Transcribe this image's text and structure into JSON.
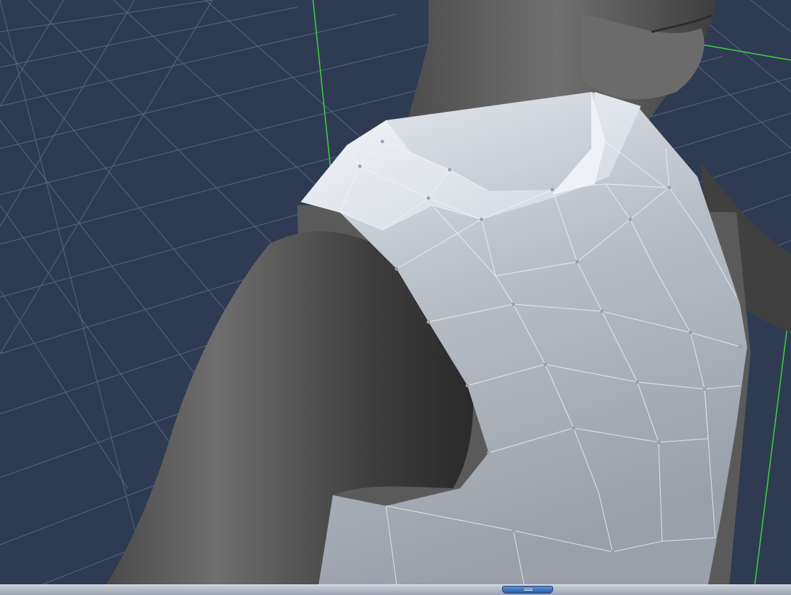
{
  "viewport": {
    "name": "3D viewport",
    "background": "#2e3b52",
    "grid_color": "#5b6f92",
    "axis_color": "#39d63a",
    "figure_skin": "#5c5c5c",
    "garment_color": "#d4d9e0",
    "mesh_line_color": "#f2f4f7"
  },
  "bottom_bar": {
    "handle_icon": "collapse-handle-icon"
  }
}
